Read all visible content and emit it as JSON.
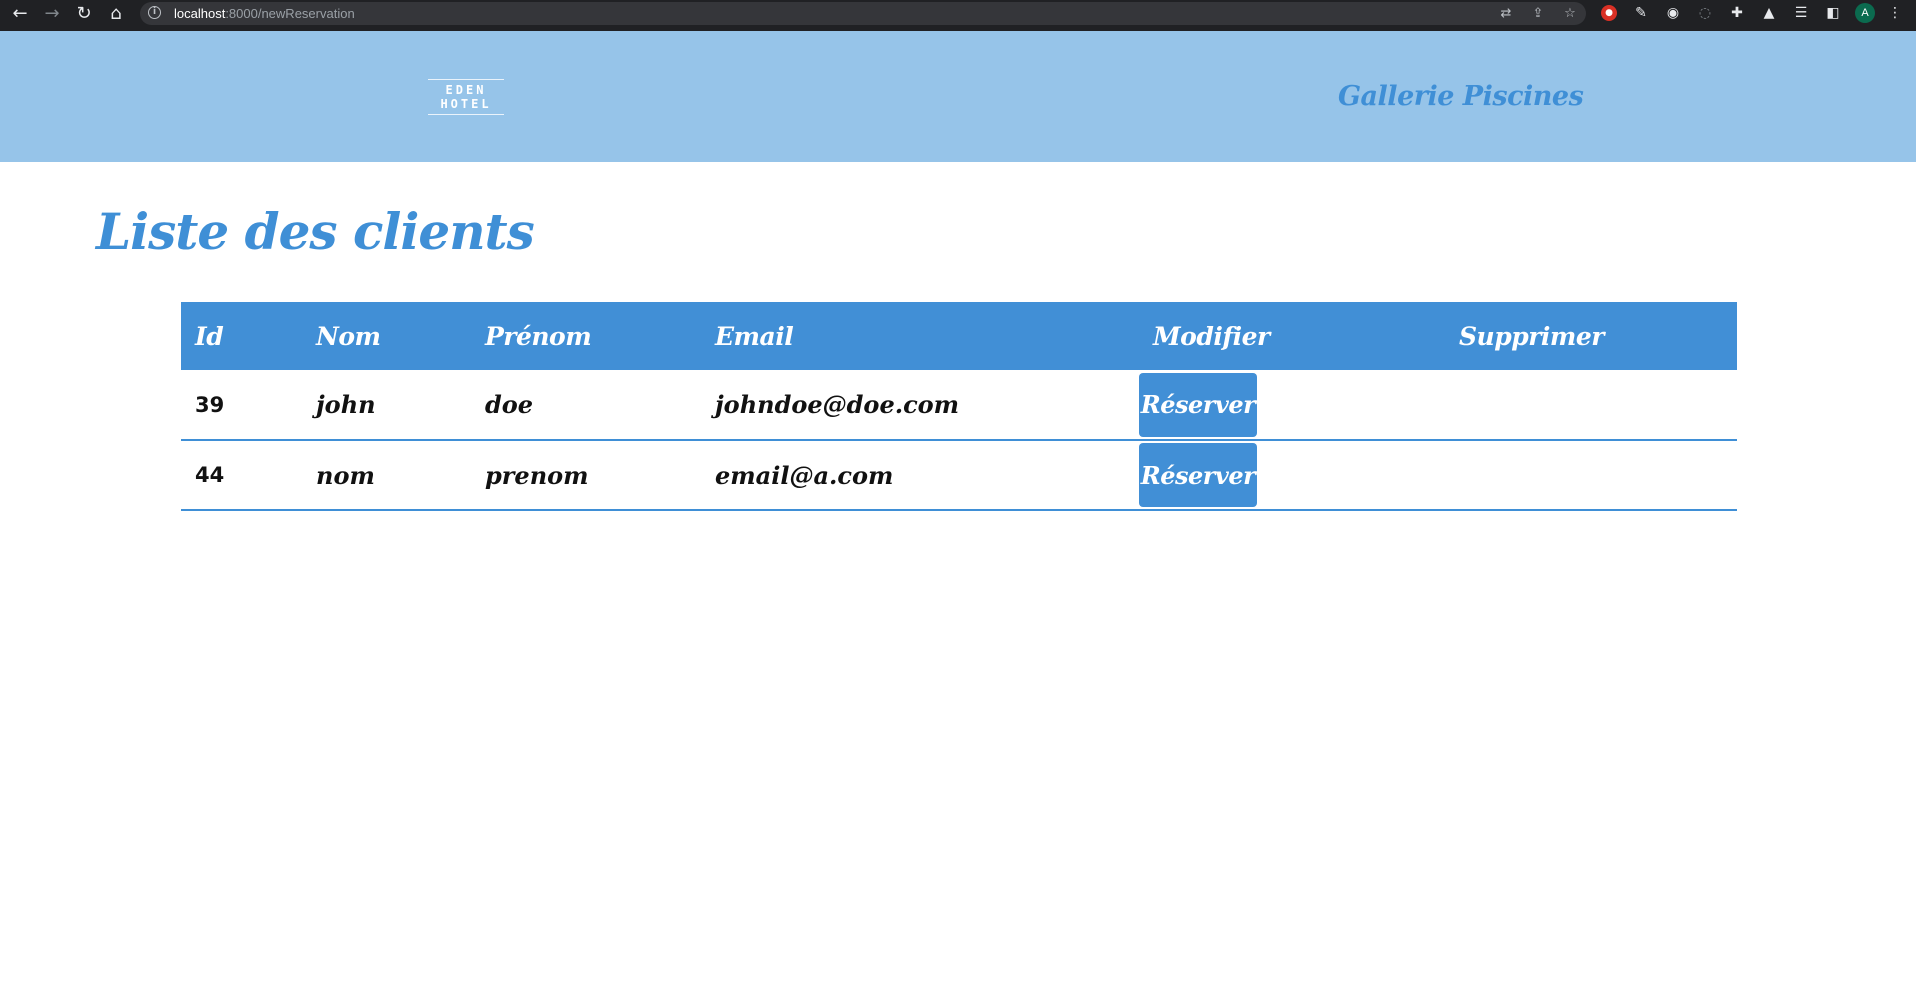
{
  "browser": {
    "url_host": "localhost",
    "url_path": ":8000/newReservation",
    "nav_icons": [
      "back-arrow-icon",
      "forward-arrow-icon",
      "reload-icon",
      "home-icon"
    ],
    "avatar_letter": "A"
  },
  "header": {
    "logo_text": "EDEN HOTEL",
    "gallery_link": "Gallerie Piscines",
    "background": "#96c4e9"
  },
  "page": {
    "title": "Liste des clients",
    "accent": "#3f8fd6"
  },
  "table": {
    "headers": {
      "id": "Id",
      "nom": "Nom",
      "prenom": "Prénom",
      "email": "Email",
      "modifier": "Modifier",
      "supprimer": "Supprimer"
    },
    "rows": [
      {
        "id": "39",
        "nom": "john",
        "prenom": "doe",
        "email": "johndoe@doe.com",
        "action": "Réserver"
      },
      {
        "id": "44",
        "nom": "nom",
        "prenom": "prenom",
        "email": "email@a.com",
        "action": "Réserver"
      }
    ]
  }
}
